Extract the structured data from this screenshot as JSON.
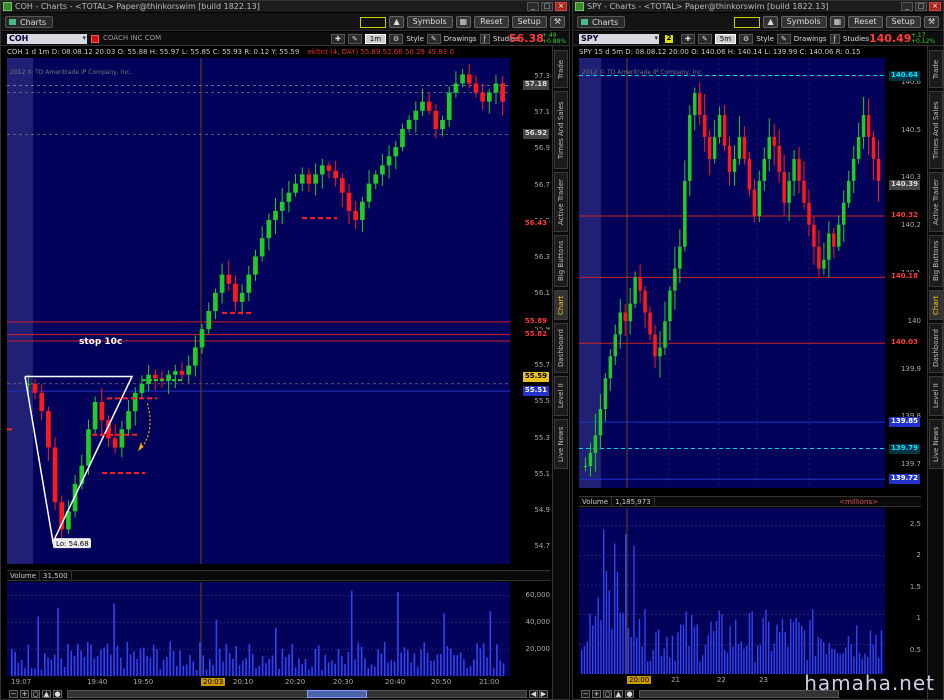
{
  "left": {
    "title": "COH - Charts - <TOTAL> Paper@thinkorswim [build 1822.13]",
    "charts_label": "Charts",
    "symbols_label": "Symbols",
    "reset_label": "Reset",
    "setup_label": "Setup",
    "symbol": "COH",
    "company": "COACH INC COM",
    "period": "1m",
    "style_label": "Style",
    "drawings_label": "Drawings",
    "studies_label": "Studies",
    "last_price": "56.38",
    "change_top": "+.49",
    "change_bottom": "+0.88%",
    "info": "COH 1 d 1m   D: 08.08.12 20:03   O: 55.88   H: 55.97   L: 55.85   C: 55.93   R: 0.12   Y: 55.59",
    "info_study": "ekltnt (4, DAY)   55.89   52.66   50.29   49.83   0",
    "copyright": "2012 © TD Ameritrade IP Company, Inc.",
    "annotation_stop": "stop 10c",
    "annotation_low": "Lo: 54.68",
    "volume_label": "Volume",
    "volume_value": "31,500",
    "price_ticks": [
      "57.3",
      "57.1",
      "56.9",
      "56.7",
      "56.5",
      "56.3",
      "56.1",
      "55.9",
      "55.7",
      "55.5",
      "55.3",
      "55.1",
      "54.9",
      "54.7"
    ],
    "price_ticks_minor": [
      "57.2",
      "57",
      "56.8",
      "56.6",
      "56.4",
      "56.2",
      "56",
      "55.8",
      "55.6",
      "55.4",
      "55.2",
      "55",
      "54.8",
      "54.6"
    ],
    "price_tags": [
      {
        "text": "57.18",
        "color": "#dddddd",
        "bg": "#444444"
      },
      {
        "text": "56.92",
        "color": "#dddddd",
        "bg": "#444444"
      },
      {
        "text": "56.43",
        "color": "#ff3a3a",
        "bg": "#000000"
      },
      {
        "text": "55.89",
        "color": "#ff3a3a",
        "bg": "#000000"
      },
      {
        "text": "55.82",
        "color": "#ff3a3a",
        "bg": "#000000"
      },
      {
        "text": "55.59",
        "color": "#000000",
        "bg": "#e8c020"
      },
      {
        "text": "55.51",
        "color": "#ffffff",
        "bg": "#2233cc"
      }
    ],
    "volume_ticks": [
      "60,000",
      "40,000",
      "20,000"
    ],
    "time_labels": [
      "19:07",
      "19:40",
      "19:50",
      "20:03",
      "20:10",
      "20:20",
      "20:30",
      "20:40",
      "20:50",
      "21:00"
    ]
  },
  "right": {
    "title": "SPY - Charts - <TOTAL> Paper@thinkorswim [build 1822.13]",
    "charts_label": "Charts",
    "symbols_label": "Symbols",
    "reset_label": "Reset",
    "setup_label": "Setup",
    "symbol": "SPY",
    "period": "5m",
    "style_label": "Style",
    "drawings_label": "Drawings",
    "studies_label": "Studies",
    "last_price": "140.49",
    "change_top": "+.17",
    "change_bottom": "+0.12%",
    "info": "SPY 15 d 5m   D: 08.08.12 20:00   O: 140.06   H: 140.14   L: 139.99   C: 140.06   R: 0.15",
    "copyright": "2012 © TD Ameritrade IP Company, Inc.",
    "volume_label": "Volume",
    "volume_value": "1,185,973",
    "volume_units": "<millions>",
    "price_ticks": [
      "140.6",
      "140.5",
      "140.3",
      "140.2",
      "140.1",
      "140",
      "139.9",
      "139.8",
      "139.7"
    ],
    "price_tags": [
      {
        "text": "140.64",
        "color": "#00e8ff",
        "bg": "#003344"
      },
      {
        "text": "140.39",
        "color": "#dddddd",
        "bg": "#444444"
      },
      {
        "text": "140.32",
        "color": "#ff3a3a",
        "bg": "#000000"
      },
      {
        "text": "140.18",
        "color": "#ff3a3a",
        "bg": "#000000"
      },
      {
        "text": "140.03",
        "color": "#ff3a3a",
        "bg": "#000000"
      },
      {
        "text": "139.85",
        "color": "#ffffff",
        "bg": "#2233cc"
      },
      {
        "text": "139.79",
        "color": "#00e8ff",
        "bg": "#003344"
      },
      {
        "text": "139.72",
        "color": "#ffffff",
        "bg": "#2233cc"
      }
    ],
    "volume_ticks": [
      "2.5",
      "2",
      "1.5",
      "1",
      "0.5"
    ],
    "time_labels": [
      "20:00",
      "21",
      "22",
      "23"
    ]
  },
  "side_tabs": [
    "Trade",
    "Times And Sales",
    "Active Trader",
    "Big Buttons",
    "Chart",
    "Dashboard",
    "Level II",
    "Live News"
  ],
  "active_tab": "Chart",
  "watermark": "hamaha.net",
  "colors": {
    "plot_bg": "#02025a",
    "up": "#22cc22",
    "down": "#ff1a1a",
    "volume": "#3344ee",
    "red_line": "#cc2222",
    "blue_line": "#2233cc",
    "cyan_line": "#00d8f0"
  }
}
